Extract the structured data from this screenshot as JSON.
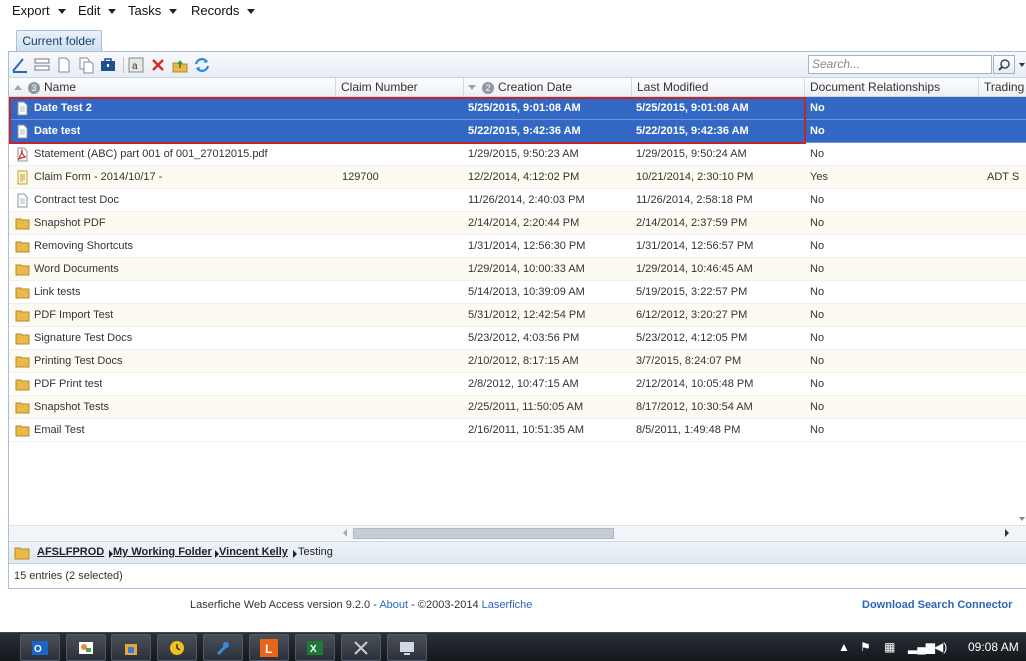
{
  "menu": {
    "items": [
      {
        "label": "Export"
      },
      {
        "label": "Edit"
      },
      {
        "label": "Tasks"
      },
      {
        "label": "Records"
      }
    ]
  },
  "tab": {
    "label": "Current folder"
  },
  "toolbar": {
    "icons": [
      "edit-icon",
      "columns-icon",
      "new-document-icon",
      "copy-icon",
      "briefcase-icon",
      "text-icon",
      "delete-icon",
      "upload-icon",
      "refresh-icon"
    ]
  },
  "search": {
    "placeholder": "Search..."
  },
  "table": {
    "columns": [
      {
        "label": "Name",
        "sort_index": "3"
      },
      {
        "label": "Claim Number"
      },
      {
        "label": "Creation Date",
        "sort_index": "2"
      },
      {
        "label": "Last Modified"
      },
      {
        "label": "Document Relationships"
      },
      {
        "label": "Trading"
      }
    ],
    "rows": [
      {
        "icon": "document-icon",
        "name": "Date Test 2",
        "claim": "",
        "created": "5/25/2015, 9:01:08 AM",
        "modified": "5/25/2015, 9:01:08 AM",
        "rel": "No",
        "trading": "",
        "selected": true
      },
      {
        "icon": "document-icon",
        "name": "Date test",
        "claim": "",
        "created": "5/22/2015, 9:42:36 AM",
        "modified": "5/22/2015, 9:42:36 AM",
        "rel": "No",
        "trading": "",
        "selected": true
      },
      {
        "icon": "pdf-icon",
        "name": "Statement (ABC) part 001 of 001_27012015.pdf",
        "claim": "",
        "created": "1/29/2015, 9:50:23 AM",
        "modified": "1/29/2015, 9:50:24 AM",
        "rel": "No",
        "trading": ""
      },
      {
        "icon": "form-icon",
        "name": "Claim Form - 2014/10/17 -",
        "claim": "129700",
        "created": "12/2/2014, 4:12:02 PM",
        "modified": "10/21/2014, 2:30:10 PM",
        "rel": "Yes",
        "trading": "ADT S"
      },
      {
        "icon": "document-icon",
        "name": "Contract test Doc",
        "claim": "",
        "created": "11/26/2014, 2:40:03 PM",
        "modified": "11/26/2014, 2:58:18 PM",
        "rel": "No",
        "trading": ""
      },
      {
        "icon": "folder-icon",
        "name": "Snapshot PDF",
        "claim": "",
        "created": "2/14/2014, 2:20:44 PM",
        "modified": "2/14/2014, 2:37:59 PM",
        "rel": "No",
        "trading": ""
      },
      {
        "icon": "folder-icon",
        "name": "Removing Shortcuts",
        "claim": "",
        "created": "1/31/2014, 12:56:30 PM",
        "modified": "1/31/2014, 12:56:57 PM",
        "rel": "No",
        "trading": ""
      },
      {
        "icon": "folder-icon",
        "name": "Word Documents",
        "claim": "",
        "created": "1/29/2014, 10:00:33 AM",
        "modified": "1/29/2014, 10:46:45 AM",
        "rel": "No",
        "trading": ""
      },
      {
        "icon": "folder-icon",
        "name": "Link tests",
        "claim": "",
        "created": "5/14/2013, 10:39:09 AM",
        "modified": "5/19/2015, 3:22:57 PM",
        "rel": "No",
        "trading": ""
      },
      {
        "icon": "folder-icon",
        "name": "PDF Import Test",
        "claim": "",
        "created": "5/31/2012, 12:42:54 PM",
        "modified": "6/12/2012, 3:20:27 PM",
        "rel": "No",
        "trading": ""
      },
      {
        "icon": "folder-icon",
        "name": "Signature Test Docs",
        "claim": "",
        "created": "5/23/2012, 4:03:56 PM",
        "modified": "5/23/2012, 4:12:05 PM",
        "rel": "No",
        "trading": ""
      },
      {
        "icon": "folder-icon",
        "name": "Printing Test Docs",
        "claim": "",
        "created": "2/10/2012, 8:17:15 AM",
        "modified": "3/7/2015, 8:24:07 PM",
        "rel": "No",
        "trading": ""
      },
      {
        "icon": "folder-icon",
        "name": "PDF Print test",
        "claim": "",
        "created": "2/8/2012, 10:47:15 AM",
        "modified": "2/12/2014, 10:05:48 PM",
        "rel": "No",
        "trading": ""
      },
      {
        "icon": "folder-icon",
        "name": "Snapshot Tests",
        "claim": "",
        "created": "2/25/2011, 11:50:05 AM",
        "modified": "8/17/2012, 10:30:54 AM",
        "rel": "No",
        "trading": ""
      },
      {
        "icon": "folder-icon",
        "name": "Email Test",
        "claim": "",
        "created": "2/16/2011, 10:51:35 AM",
        "modified": "8/5/2011, 1:49:48 PM",
        "rel": "No",
        "trading": ""
      }
    ]
  },
  "breadcrumb": {
    "items": [
      "AFSLFPROD",
      "My Working Folder",
      "Vincent Kelly",
      "Testing"
    ]
  },
  "status": {
    "text": "15 entries (2 selected)"
  },
  "footer": {
    "version": "Laserfiche Web Access version 9.2.0 - ",
    "about": "About",
    "copyright": " - ©2003-2014 ",
    "brand": "Laserfiche",
    "download": "Download Search Connector"
  },
  "taskbar": {
    "apps": [
      "outlook-icon",
      "paint-icon",
      "store-icon",
      "clock-app-icon",
      "tools-icon",
      "laserfiche-icon",
      "excel-icon",
      "snipping-icon",
      "remote-icon"
    ],
    "clock": "09:08 AM"
  },
  "colors": {
    "selection": "#3268c4",
    "highlight_box": "#c0272d",
    "link": "#2a66b8"
  }
}
